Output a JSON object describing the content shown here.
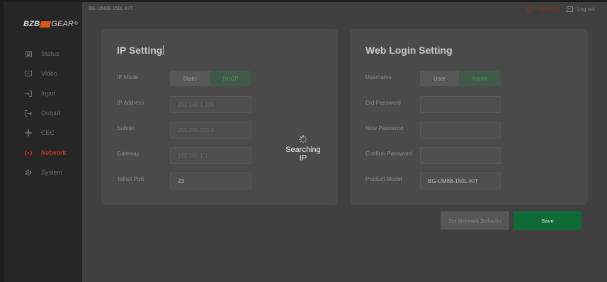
{
  "brand": {
    "name_left": "BZB",
    "name_right": "GEAR",
    "trademark": "®",
    "accent": "#d8571a"
  },
  "sidebar": {
    "items": [
      {
        "label": "Status",
        "icon": "status-icon"
      },
      {
        "label": "Video",
        "icon": "video-icon"
      },
      {
        "label": "Input",
        "icon": "input-icon"
      },
      {
        "label": "Output",
        "icon": "output-icon"
      },
      {
        "label": "CEC",
        "icon": "cec-icon"
      },
      {
        "label": "Network",
        "icon": "network-icon",
        "active": true
      },
      {
        "label": "System",
        "icon": "system-icon"
      }
    ]
  },
  "topbar": {
    "breadcrumb": "BG-UM88-150L-KIT",
    "power_label": "Power on",
    "logout_label": "Log out"
  },
  "ip_setting": {
    "title": "IP Setting",
    "ip_mode_label": "IP Mode",
    "mode_options": [
      "Static",
      "DHCP"
    ],
    "mode_selected": "DHCP",
    "ip_address_label": "IP Address",
    "ip_address_value": "192.168.1.100",
    "subnet_label": "Subnet",
    "subnet_value": "255.255.255.0",
    "gateway_label": "Gateway",
    "gateway_value": "192.168.1.1",
    "telnet_label": "Telnet Port",
    "telnet_value": "23"
  },
  "web_login": {
    "title": "Web Login Setting",
    "username_label": "Username",
    "user_options": [
      "User",
      "Admin"
    ],
    "user_selected": "Admin",
    "old_password_label": "Old Password",
    "new_password_label": "New Password",
    "confirm_password_label": "Confirm Password",
    "product_model_label": "Product Model",
    "product_model_value": "BG-UM88-150L-KIT"
  },
  "actions": {
    "defaults_label": "Set Network Defaults",
    "save_label": "Save"
  },
  "overlay": {
    "loading_text": "Searching IP",
    "spinner_icon": "spinner-icon"
  },
  "colors": {
    "active_nav": "#b8371f",
    "toggle_on": "#4a8f64",
    "save": "#0f6b36"
  }
}
